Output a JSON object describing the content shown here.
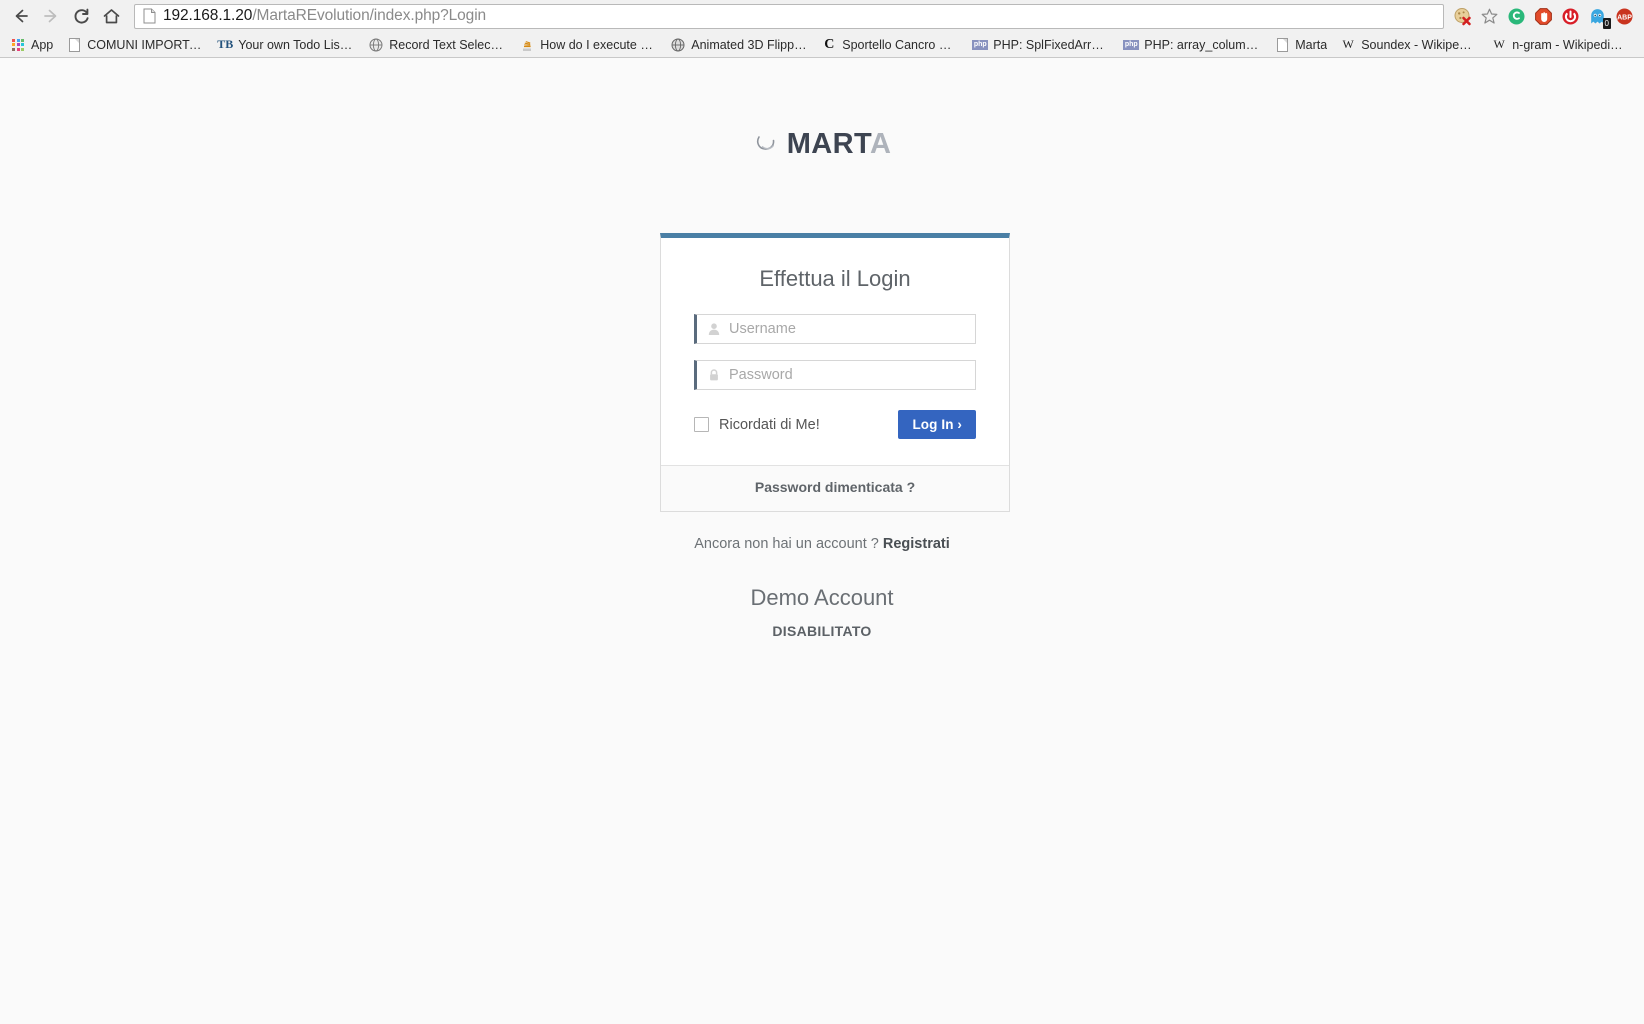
{
  "browser": {
    "nav": {
      "back_label": "Back",
      "forward_label": "Forward",
      "reload_label": "Reload",
      "home_label": "Home"
    },
    "url": {
      "host": "192.168.1.20",
      "path": "/MartaREvolution/index.php?Login",
      "full": "192.168.1.20/MartaREvolution/index.php?Login",
      "page_icon": "document-icon"
    },
    "extensions": [
      {
        "name": "cookie-blocker-icon",
        "label": "Cookie blocker"
      },
      {
        "name": "bookmark-star-icon",
        "label": "Bookmark this page"
      },
      {
        "name": "green-circle-extension-icon",
        "label": "Extension"
      },
      {
        "name": "stop-hand-extension-icon",
        "label": "Extension"
      },
      {
        "name": "red-shield-extension-icon",
        "label": "Extension"
      },
      {
        "name": "ghostery-icon",
        "label": "Ghostery",
        "badge": "0"
      },
      {
        "name": "adblock-plus-icon",
        "label": "ABP"
      }
    ],
    "bookmarks": [
      {
        "label": "App",
        "icon": "apps-grid-icon"
      },
      {
        "label": "COMUNI IMPORTA...",
        "icon": "document-icon"
      },
      {
        "label": "Your own Todo List ...",
        "icon": "tb-icon"
      },
      {
        "label": "Record Text Selectio...",
        "icon": "globe-icon"
      },
      {
        "label": "How do I execute m...",
        "icon": "stackoverflow-icon"
      },
      {
        "label": "Animated 3D Flippin...",
        "icon": "globe-icon"
      },
      {
        "label": "Sportello Cancro Co...",
        "icon": "c-icon"
      },
      {
        "label": "PHP: SplFixedArray -...",
        "icon": "php-icon"
      },
      {
        "label": "PHP: array_column ...",
        "icon": "php-icon"
      },
      {
        "label": "Marta",
        "icon": "document-icon"
      },
      {
        "label": "Soundex - Wikipedia...",
        "icon": "wikipedia-icon"
      },
      {
        "label": "n-gram - Wikipedia,...",
        "icon": "wikipedia-icon"
      }
    ]
  },
  "page": {
    "brand": {
      "name_dark": "MART",
      "name_light": "A",
      "logo_icon": "crescent-swoosh-icon"
    },
    "login": {
      "title": "Effettua il Login",
      "username": {
        "value": "",
        "placeholder": "Username",
        "icon": "user-icon"
      },
      "password": {
        "value": "",
        "placeholder": "Password",
        "icon": "lock-icon"
      },
      "remember_label": "Ricordati di Me!",
      "remember_checked": false,
      "submit_label": "Log In ›",
      "forgot_password_label": "Password dimenticata ?"
    },
    "signup": {
      "prompt": "Ancora non hai un account ?",
      "link_label": "Registrati"
    },
    "demo": {
      "title": "Demo Account",
      "status": "DISABILITATO"
    },
    "colors": {
      "panel_top_border": "#4a7fa5",
      "field_left_border": "#5a6b7d",
      "submit_background": "#3465c0",
      "page_background": "#fafafa"
    }
  }
}
